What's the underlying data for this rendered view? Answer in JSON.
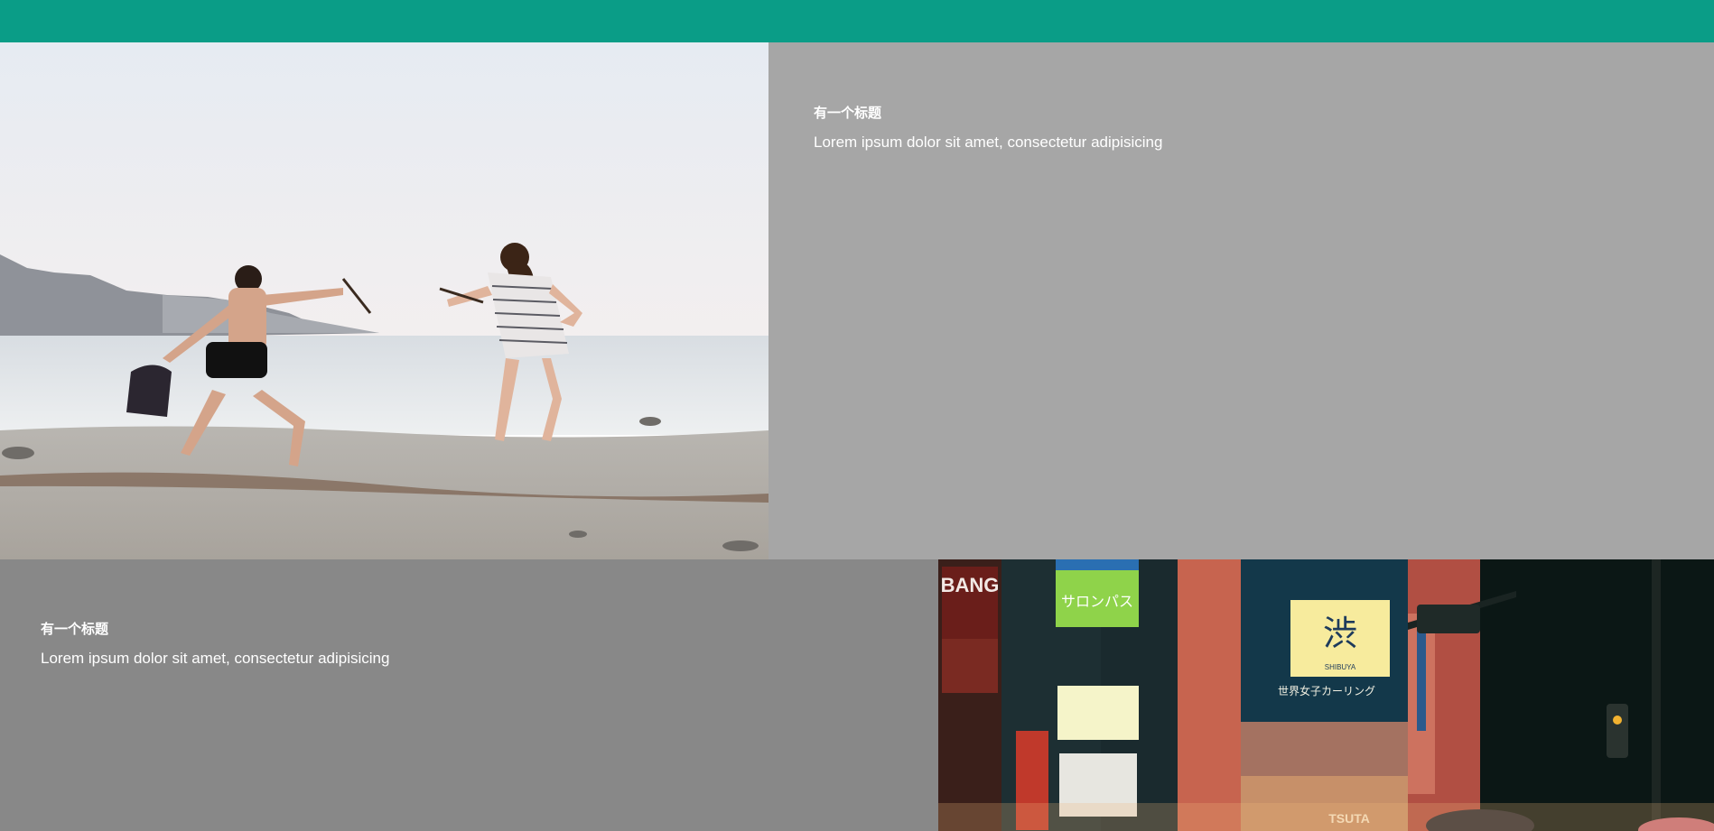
{
  "cards": [
    {
      "title": "有一个标题",
      "text": "Lorem ipsum dolor sit amet, consectetur adipisicing",
      "image": "beach-photo"
    },
    {
      "title": "有一个标题",
      "text": "Lorem ipsum dolor sit amet, consectetur adipisicing",
      "image": "city-night-photo"
    }
  ],
  "colors": {
    "header": "#0a9d87",
    "panel_light": "#a6a6a6",
    "panel_dark": "#888888",
    "text": "#ffffff"
  },
  "city_photo": {
    "signs": [
      "BANG",
      "サロンパス",
      "渋",
      "SHIBUYA",
      "世界女子カーリング",
      "TSUTA"
    ]
  }
}
